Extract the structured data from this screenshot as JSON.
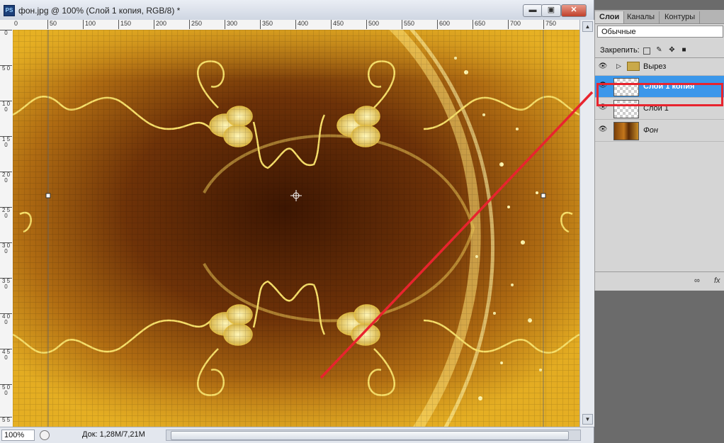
{
  "window": {
    "app_icon": "PS",
    "title": "фон.jpg @ 100% (Слой 1 копия, RGB/8) *",
    "minimize_label": "▬",
    "maximize_label": "▣",
    "close_label": "✕"
  },
  "ruler": {
    "h_ticks": [
      "0",
      "50",
      "100",
      "150",
      "200",
      "250",
      "300",
      "350",
      "400",
      "450",
      "500",
      "550",
      "600",
      "650",
      "700",
      "750"
    ],
    "v_ticks": [
      "0",
      "5 0",
      "1 0 0",
      "1 5 0",
      "2 0 0",
      "2 5 0",
      "3 0 0",
      "3 5 0",
      "4 0 0",
      "4 5 0",
      "5 0 0",
      "5 5"
    ]
  },
  "status": {
    "zoom": "100%",
    "doc": "Док: 1,28M/7,21M"
  },
  "panel": {
    "tabs": [
      "Слои",
      "Каналы",
      "Контуры"
    ],
    "blend_mode": "Обычные",
    "lock_label": "Закрепить:",
    "layers": [
      {
        "name": "Вырез",
        "type": "group",
        "selected": false
      },
      {
        "name": "Слой 1 копия",
        "type": "transparent",
        "selected": true
      },
      {
        "name": "Слой 1",
        "type": "transparent",
        "selected": false
      },
      {
        "name": "Фон",
        "type": "background",
        "selected": false
      }
    ],
    "link_icon": "∞",
    "fx_label": "fx"
  },
  "colors": {
    "highlight": "#3b97ea",
    "annotation_red": "#e8242e",
    "image_gold": "#d9a21e",
    "image_brown": "#4a1e04"
  }
}
